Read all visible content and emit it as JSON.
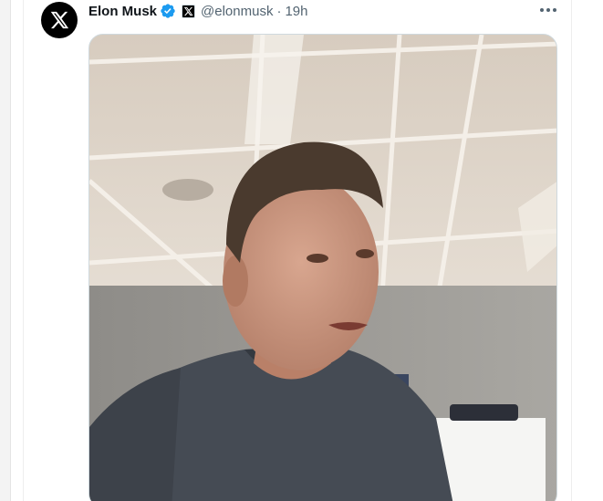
{
  "tweet": {
    "display_name": "Elon Musk",
    "handle": "@elonmusk",
    "separator": "·",
    "time": "19h",
    "avatar_icon": "x-logo-icon",
    "verified_icon": "verified-badge-icon",
    "affiliation_icon": "x-affiliation-icon",
    "more_icon": "more-options-icon",
    "colors": {
      "verified": "#1d9bf0",
      "secondary_text": "#536471",
      "primary_text": "#0f1419"
    }
  }
}
